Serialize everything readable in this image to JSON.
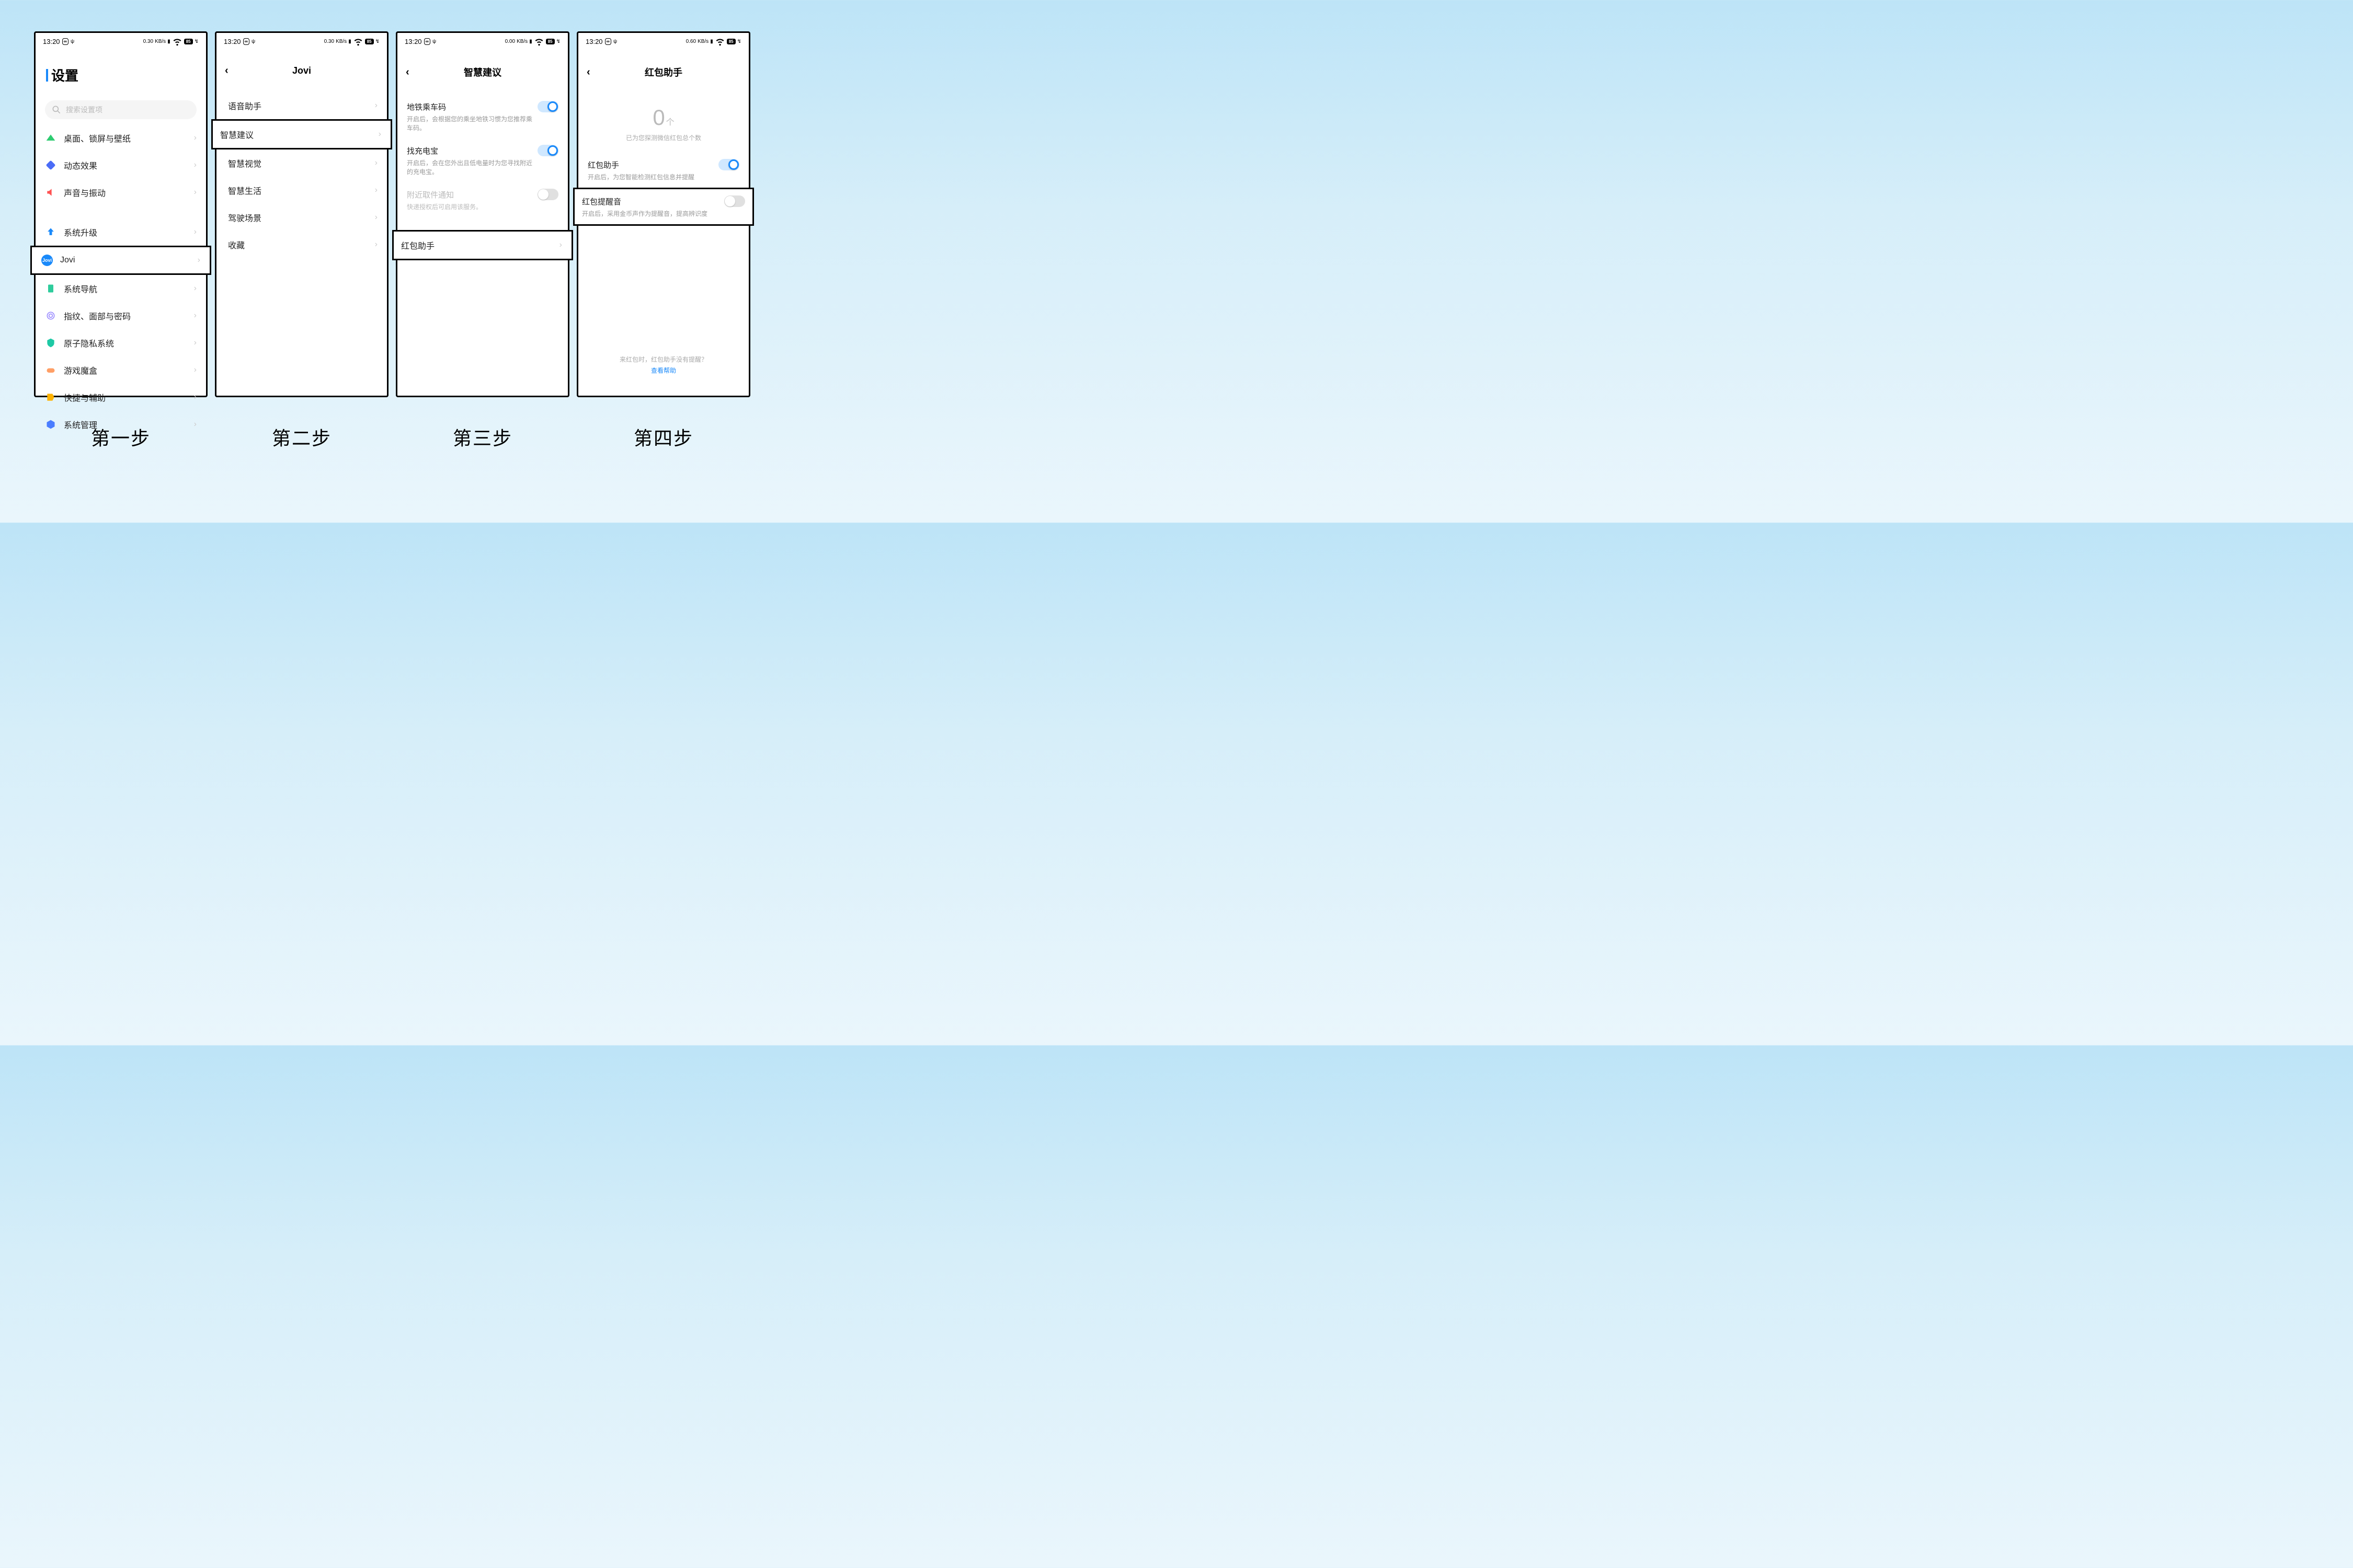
{
  "status": {
    "time": "13:20",
    "net_speed": "0.30",
    "net_unit": "KB/s",
    "battery": "85"
  },
  "steps": {
    "s1": "第一步",
    "s2": "第二步",
    "s3": "第三步",
    "s4": "第四步"
  },
  "screen1": {
    "title": "设置",
    "search_placeholder": "搜索设置项",
    "items": {
      "desktop": "桌面、锁屏与壁纸",
      "dynamic": "动态效果",
      "sound": "声音与振动",
      "upgrade": "系统升级",
      "jovi": "Jovi",
      "nav": "系统导航",
      "biometric": "指纹、面部与密码",
      "privacy": "原子隐私系统",
      "gamebox": "游戏魔盒",
      "shortcut": "快捷与辅助",
      "sysmgmt": "系统管理"
    }
  },
  "screen2": {
    "title": "Jovi",
    "items": {
      "voice": "语音助手",
      "smart_suggest": "智慧建议",
      "smart_vision": "智慧视觉",
      "smart_life": "智慧生活",
      "driving": "驾驶场景",
      "favorites": "收藏"
    }
  },
  "screen3": {
    "title": "智慧建议",
    "metro": {
      "label": "地铁乘车码",
      "desc": "开启后，会根据您的乘坐地铁习惯为您推荐乘车码。"
    },
    "powerbank": {
      "label": "找充电宝",
      "desc": "开启后，会在您外出且低电量时为您寻找附近的充电宝。"
    },
    "pickup": {
      "label": "附近取件通知",
      "desc": "快递授权后可启用该服务。"
    },
    "redpacket": {
      "label": "红包助手"
    }
  },
  "screen4": {
    "title": "红包助手",
    "count": "0",
    "count_unit": "个",
    "count_sub": "已为您探测微信红包总个数",
    "assist": {
      "label": "红包助手",
      "desc": "开启后，为您智能检测红包信息并提醒"
    },
    "sound": {
      "label": "红包提醒音",
      "desc": "开启后，采用金币声作为提醒音，提高辨识度"
    },
    "help_q": "来红包时，红包助手没有提醒？",
    "help_link": "查看帮助"
  }
}
